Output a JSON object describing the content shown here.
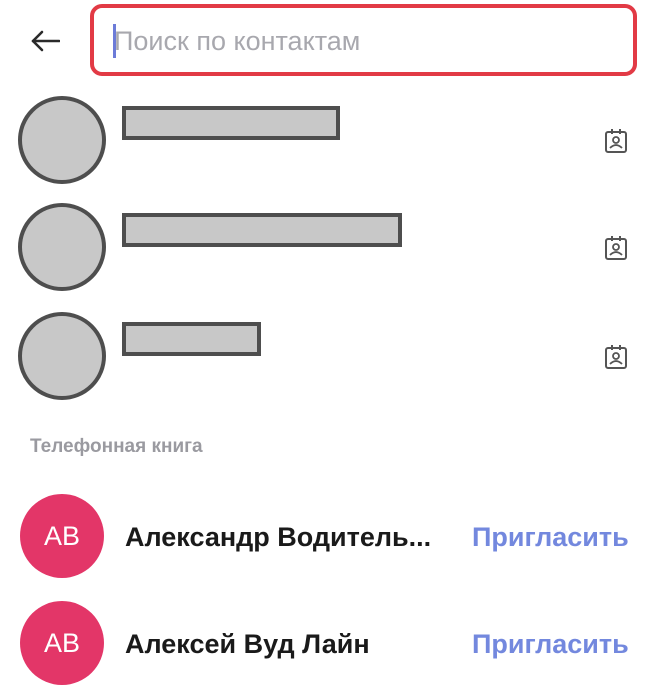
{
  "header": {
    "back_icon": "arrow-left-icon",
    "search": {
      "placeholder": "Поиск по контактам",
      "value": ""
    }
  },
  "contacts": {
    "icon": "contact-card-icon",
    "items": [
      {
        "name_redacted": true
      },
      {
        "name_redacted": true
      },
      {
        "name_redacted": true
      }
    ]
  },
  "phonebook": {
    "section_title": "Телефонная книга",
    "items": [
      {
        "initials": "АВ",
        "name": "Александр Водитель...",
        "action": "Пригласить"
      },
      {
        "initials": "АВ",
        "name": "Алексей Вуд Лайн",
        "action": "Пригласить"
      }
    ]
  },
  "colors": {
    "search_border": "#e23a45",
    "avatar_bg": "#e33668",
    "invite_link": "#7388de",
    "section_label": "#9a9aa0"
  }
}
